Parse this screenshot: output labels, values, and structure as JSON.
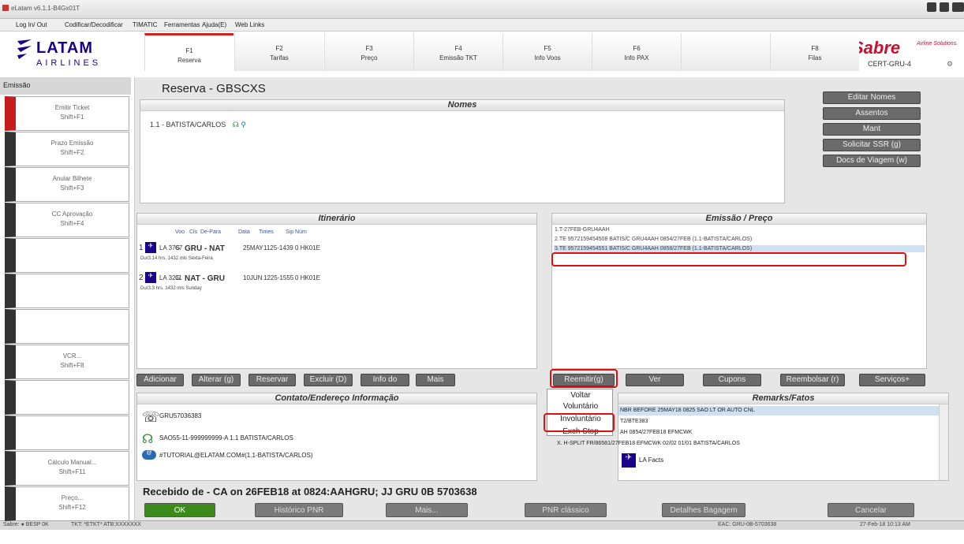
{
  "window": {
    "title": "eLatam v6.1.1-B4Gx01T"
  },
  "menu": [
    "Log In/ Out",
    "Codificar/Decodificar",
    "TIMATIC",
    "Ferramentas",
    "Ajuda(E)",
    "Web Links"
  ],
  "logo": {
    "l1": "LATAM",
    "l2": "AIRLINES"
  },
  "fkeys": [
    {
      "k": "F1",
      "l": "Reserva"
    },
    {
      "k": "F2",
      "l": "Tarifas"
    },
    {
      "k": "F3",
      "l": "Preço"
    },
    {
      "k": "F4",
      "l": "Emissão TKT"
    },
    {
      "k": "F5",
      "l": "Info Voos"
    },
    {
      "k": "F6",
      "l": "Info PAX"
    },
    {
      "k": "",
      "l": ""
    },
    {
      "k": "F8",
      "l": "Filas"
    }
  ],
  "sabre": {
    "brand": "Sabre",
    "sub": "Airline Solutions.",
    "cert": "CERT-GRU-4"
  },
  "sidebar": {
    "header": "Emissão",
    "items": [
      {
        "l": "Emitir Ticket",
        "s": "Shift+F1"
      },
      {
        "l": "Prazo Emissão",
        "s": "Shift+F2"
      },
      {
        "l": "Anular Bilhete",
        "s": "Shift+F3"
      },
      {
        "l": "CC Aprovação",
        "s": "Shift+F4"
      },
      {
        "l": "",
        "s": ""
      },
      {
        "l": "",
        "s": ""
      },
      {
        "l": "",
        "s": ""
      },
      {
        "l": "VCR...",
        "s": "Shift+F8"
      },
      {
        "l": "",
        "s": ""
      },
      {
        "l": "",
        "s": ""
      },
      {
        "l": "Cálculo Manual...",
        "s": "Shift+F11"
      },
      {
        "l": "Preço...",
        "s": "Shift+F12"
      }
    ]
  },
  "reserva": {
    "title": "Reserva - GBSCXS"
  },
  "nomes": {
    "header": "Nomes",
    "row": "1.1 -  BATISTA/CARLOS"
  },
  "right_buttons": [
    "Editar Nomes",
    "Assentos",
    "Mant",
    "Solicitar SSR (g)",
    "Docs de Viagem (w)"
  ],
  "itinerario": {
    "header": "Itinerário",
    "cols": [
      "Voo",
      "Cls",
      "De-Para",
      "Data",
      "Times",
      "Sip Núm"
    ],
    "segments": [
      {
        "n": "1",
        "flight": "LA 3767",
        "cls": "G",
        "route": "GRU - NAT",
        "date": "25MAY",
        "times": "1125-1439",
        "stat": "0  HK01E",
        "sub": "Dur3.14 hrs. 1432 mls Sexta-Feira"
      },
      {
        "n": "2",
        "flight": "LA 3211",
        "cls": "G",
        "route": "NAT - GRU",
        "date": "10JUN",
        "times": "1225-1555",
        "stat": "0  HK01E",
        "sub": "Dur3.3 hrs. 1432 mls Sunday"
      }
    ],
    "buttons": [
      "Adicionar",
      "Alterar (g)",
      "Reservar",
      "Excluir (D)",
      "Info do Voo(I)",
      "Mais"
    ]
  },
  "emissao": {
    "header": "Emissão / Preço",
    "rows": [
      "1.T-27FEB-GRU4AAH",
      "2.TE 9572159454508 BATIS/C GRU4AAH 0854/27FEB (1.1-BATISTA/CARLOS)",
      "3.TE 9572159454551 BATIS/C GRU4AAH 0858/27FEB (1.1-BATISTA/CARLOS)"
    ],
    "buttons": [
      "Reemitir(g)",
      "Ver",
      "Cupons",
      "Reembolsar (r)",
      "Serviços+"
    ]
  },
  "dropdown": [
    "Voltar",
    "Voluntário",
    "Involuntário",
    "Exch Stop"
  ],
  "contato": {
    "header": "Contato/Endereço Informação",
    "rows": [
      "GRU57036383",
      "SAO55-11-999999999-A 1.1 BATISTA/CARLOS",
      "#TUTORIAL@ELATAM.COM#(1.1-BATISTA/CARLOS)"
    ]
  },
  "remarks": {
    "header": "Remarks/Fatos",
    "rows": [
      "NBR BEFORE 25MAY18 0825 SAO LT OR AUTO CNL",
      "T2/BTE383",
      "AH 0854/27FEB18 EFMCWK",
      "X. H-SPLIT FR/86581/27FEB18 EFMCWK 02/02 01/01 BATISTA/CARLOS"
    ],
    "facts": "LA Facts"
  },
  "recebido": "Recebido de - CA on 26FEB18 at 0824:AAHGRU; JJ GRU 0B 5703638",
  "bottom": [
    "OK",
    "Histórico PNR",
    "Mais...",
    "PNR clássico",
    "Detalhes Bagagem",
    "Cancelar"
  ],
  "status": {
    "left": "Sabre: ● BESP 0K",
    "mid": "TKT: *ETKT* ATB:XXXXXXX",
    "right1": "EAC: GRU-0B-5703638",
    "right2": "27-Feb-18 10:13 AM"
  },
  "colors": {
    "accent": "#d32020",
    "sabre": "#c8102e",
    "latam": "#1b0088"
  }
}
